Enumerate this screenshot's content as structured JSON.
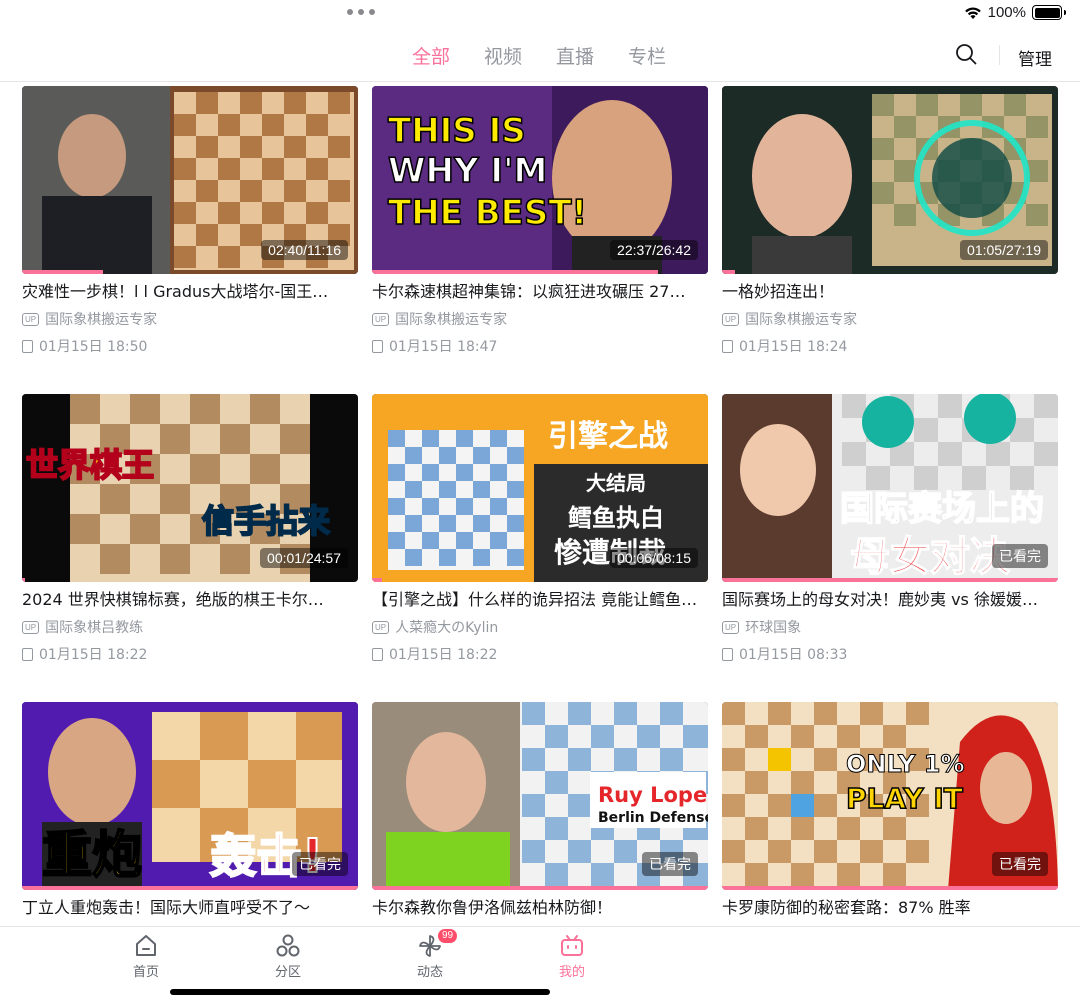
{
  "status": {
    "battery": "100%"
  },
  "tabs": [
    "全部",
    "视频",
    "直播",
    "专栏"
  ],
  "header": {
    "manage_label": "管理"
  },
  "videos": [
    {
      "title": "灾难性一步棋！l l Gradus大战塔尔-国王…",
      "uploader": "国际象棋搬运专家",
      "date": "01月15日 18:50",
      "duration": "02:40/11:16",
      "progress": 0.24,
      "thumb_text": ""
    },
    {
      "title": "卡尔森速棋超神集锦：以疯狂进攻碾压 27…",
      "uploader": "国际象棋搬运专家",
      "date": "01月15日 18:47",
      "duration": "22:37/26:42",
      "progress": 0.85,
      "thumb_text": "THIS IS WHY I'M THE BEST!"
    },
    {
      "title": "一格妙招连出！",
      "uploader": "国际象棋搬运专家",
      "date": "01月15日 18:24",
      "duration": "01:05/27:19",
      "progress": 0.04,
      "thumb_text": ""
    },
    {
      "title": "2024 世界快棋锦标赛，绝版的棋王卡尔…",
      "uploader": "国际象棋吕教练",
      "date": "01月15日 18:22",
      "duration": "00:01/24:57",
      "progress": 0.01,
      "thumb_text": "世界棋王 信手拈来"
    },
    {
      "title": "【引擎之战】什么样的诡异招法 竟能让鳕鱼…",
      "uploader": "人菜瘾大のKylin",
      "date": "01月15日 18:22",
      "duration": "00:06/08:15",
      "progress": 0.03,
      "thumb_text": "引擎之战 大结局 鳕鱼执白 惨遭制裁"
    },
    {
      "title": "国际赛场上的母女对决！鹿妙夷 vs 徐媛媛…",
      "uploader": "环球国象",
      "date": "01月15日 08:33",
      "duration": "已看完",
      "progress": 1.0,
      "thumb_text": "国际赛场上的 母女对决"
    },
    {
      "title": "丁立人重炮轰击！国际大师直呼受不了～",
      "uploader": "",
      "date": "",
      "duration": "已看完",
      "progress": 1.0,
      "thumb_text": "重炮轰击!"
    },
    {
      "title": "卡尔森教你鲁伊洛佩兹柏林防御！",
      "uploader": "",
      "date": "",
      "duration": "已看完",
      "progress": 1.0,
      "thumb_text": "Ruy Lopez Berlin Defense"
    },
    {
      "title": "卡罗康防御的秘密套路：87% 胜率",
      "uploader": "",
      "date": "",
      "duration": "已看完",
      "progress": 1.0,
      "thumb_text": "ONLY 1% PLAY IT"
    }
  ],
  "bottom_nav": [
    {
      "label": "首页",
      "icon": "home-icon"
    },
    {
      "label": "分区",
      "icon": "category-icon"
    },
    {
      "label": "动态",
      "icon": "dynamic-icon",
      "badge": "99"
    },
    {
      "label": "我的",
      "icon": "tv-icon"
    }
  ],
  "colors": {
    "accent": "#fb7299",
    "text": "#18191c",
    "muted": "#9499a0"
  }
}
